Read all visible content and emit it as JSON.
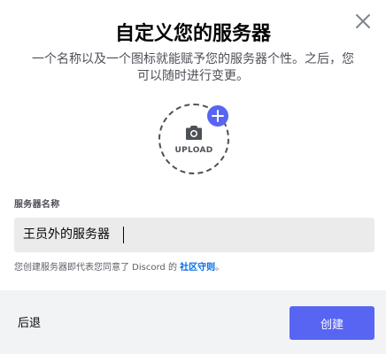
{
  "modal": {
    "title": "自定义您的服务器",
    "subtitle": "一个名称以及一个图标就能赋予您的服务器个性。之后，您可以随时进行变更。",
    "close_icon": "close-icon"
  },
  "upload": {
    "label": "UPLOAD",
    "camera_icon": "camera-icon",
    "plus_icon": "plus-icon"
  },
  "server_name": {
    "label": "服务器名称",
    "value": "王员外的服务器"
  },
  "terms": {
    "prefix": "您创建服务器即代表您同意了 Discord 的 ",
    "link": "社区守则",
    "suffix": "。"
  },
  "footer": {
    "back_label": "后退",
    "create_label": "创建"
  },
  "colors": {
    "accent": "#5865f2",
    "link": "#006ce7",
    "footer_bg": "#f2f3f5",
    "input_bg": "#ebebeb"
  }
}
